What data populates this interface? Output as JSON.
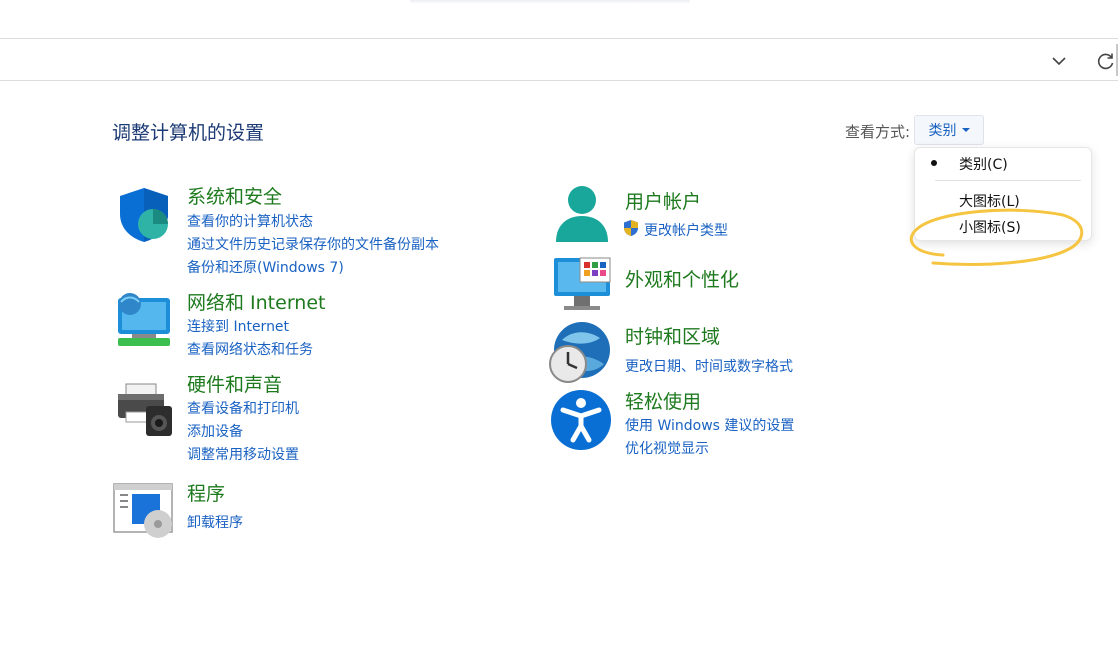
{
  "page": {
    "title": "调整计算机的设置"
  },
  "view": {
    "label": "查看方式:",
    "selected": "类别",
    "menu": [
      "类别(C)",
      "大图标(L)",
      "小图标(S)"
    ]
  },
  "categories": {
    "system": {
      "title": "系统和安全",
      "links": [
        "查看你的计算机状态",
        "通过文件历史记录保存你的文件备份副本",
        "备份和还原(Windows 7)"
      ]
    },
    "network": {
      "title": "网络和 Internet",
      "links": [
        "连接到 Internet",
        "查看网络状态和任务"
      ]
    },
    "hardware": {
      "title": "硬件和声音",
      "links": [
        "查看设备和打印机",
        "添加设备",
        "调整常用移动设置"
      ]
    },
    "programs": {
      "title": "程序",
      "links": [
        "卸载程序"
      ]
    },
    "accounts": {
      "title": "用户帐户",
      "links": [
        "更改帐户类型"
      ]
    },
    "appearance": {
      "title": "外观和个性化",
      "links": []
    },
    "clock": {
      "title": "时钟和区域",
      "links": [
        "更改日期、时间或数字格式"
      ]
    },
    "ease": {
      "title": "轻松使用",
      "links": [
        "使用 Windows 建议的设置",
        "优化视觉显示"
      ]
    }
  },
  "icons": {
    "system": "shield-icon",
    "network": "network-monitor-icon",
    "hardware": "printer-speaker-icon",
    "programs": "programs-window-icon",
    "accounts": "user-account-icon",
    "appearance": "desktop-personalize-icon",
    "clock": "globe-clock-icon",
    "ease": "accessibility-icon",
    "uac": "uac-shield-icon"
  },
  "colors": {
    "category_title": "#1e7a1e",
    "link": "#1a62c2",
    "title": "#1c3a75",
    "highlight": "#f5c542"
  }
}
